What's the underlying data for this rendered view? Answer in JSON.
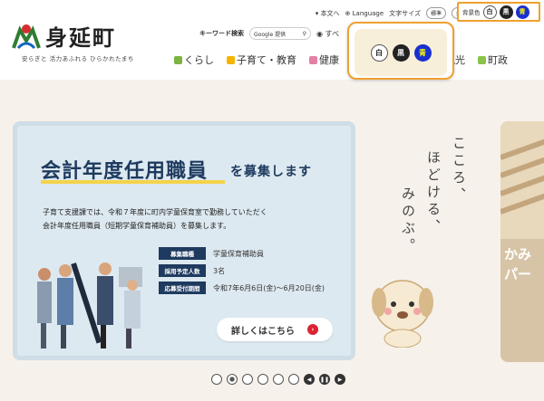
{
  "site": {
    "title": "身延町",
    "tagline": "安らぎと 活力あふれる ひらかれたまち"
  },
  "utility": {
    "main_text": "本文へ",
    "language": "Language",
    "font_size_label": "文字サイズ",
    "font_standard": "標準",
    "font_large": "拡大",
    "bg_label": "背景色",
    "bg_white": "白",
    "bg_black": "黒",
    "bg_blue": "青"
  },
  "search": {
    "label": "キーワード検索",
    "placeholder": "Google 提供",
    "scope": "すべ"
  },
  "nav": {
    "items": [
      {
        "label": "くらし",
        "color": "#7cb342"
      },
      {
        "label": "子育て・教育",
        "color": "#f4b400"
      },
      {
        "label": "健康",
        "color": "#e57fa6"
      },
      {
        "label": "観光",
        "color": "#d64a8b"
      },
      {
        "label": "町政",
        "color": "#8bc34a"
      }
    ]
  },
  "popup": {
    "white": "白",
    "black": "黒",
    "blue": "青"
  },
  "banner": {
    "title": "会計年度任用職員",
    "title_suffix": "を募集します",
    "text_line1": "子育て支援課では、令和７年度に町内学童保育室で勤務していただく",
    "text_line2": "会計年度任用職員（短期学童保育補助員）を募集します。",
    "rows": [
      {
        "label": "募集職種",
        "value": "学童保育補助員"
      },
      {
        "label": "採用予定人数",
        "value": "3名"
      },
      {
        "label": "応募受付期間",
        "value": "令和7年6月6日(金)～6月20日(金)"
      }
    ],
    "more": "詳しくはこちら"
  },
  "hero": {
    "line1": "こころ、",
    "line2": "ほどける、",
    "line3": "みのぶ。"
  },
  "side_card": {
    "line1": "かみ",
    "line2": "パー"
  },
  "pager": {
    "dots": 6,
    "active": 2
  }
}
